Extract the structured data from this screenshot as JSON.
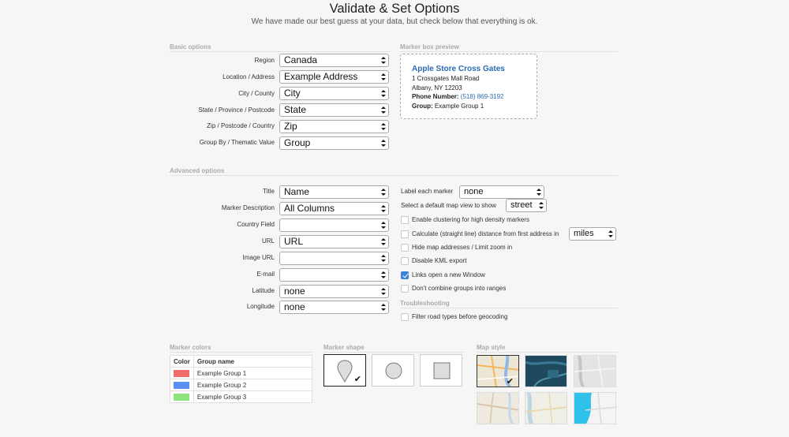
{
  "header": {
    "title": "Validate & Set Options",
    "subtitle": "We have made our best guess at your data, but check below that everything is ok."
  },
  "basic": {
    "section_label": "Basic options",
    "fields": [
      {
        "label": "Region",
        "value": "Canada"
      },
      {
        "label": "Location / Address",
        "value": "Example Address"
      },
      {
        "label": "City / County",
        "value": "City"
      },
      {
        "label": "State / Province / Postcode",
        "value": "State"
      },
      {
        "label": "Zip / Postcode / Country",
        "value": "Zip"
      },
      {
        "label": "Group By / Thematic Value",
        "value": "Group"
      }
    ]
  },
  "preview": {
    "section_label": "Marker box preview",
    "title": "Apple Store Cross Gates",
    "address1": "1 Crossgates Mall Road",
    "address2": "Albany, NY 12203",
    "phone_label": "Phone Number:",
    "phone": "(518) 869-3192",
    "group_label": "Group:",
    "group": "Example Group 1"
  },
  "advanced": {
    "section_label": "Advanced options",
    "fields": [
      {
        "label": "Title",
        "value": "Name"
      },
      {
        "label": "Marker Description",
        "value": "All Columns"
      },
      {
        "label": "Country Field",
        "value": ""
      },
      {
        "label": "URL",
        "value": "URL"
      },
      {
        "label": "Image URL",
        "value": ""
      },
      {
        "label": "E-mail",
        "value": ""
      },
      {
        "label": "Latitude",
        "value": "none"
      },
      {
        "label": "Longitude",
        "value": "none"
      }
    ],
    "label_each_marker": {
      "label": "Label each marker",
      "value": "none"
    },
    "default_map_view": {
      "label": "Select a default map view to show",
      "value": "street"
    },
    "options": [
      {
        "label": "Enable clustering for high density markers",
        "checked": false
      },
      {
        "label": "Calculate (straight line) distance from first address in",
        "checked": false,
        "unit": "miles"
      },
      {
        "label": "Hide map addresses / Limit zoom in",
        "checked": false
      },
      {
        "label": "Disable KML export",
        "checked": false
      },
      {
        "label": "Links open a new Window",
        "checked": true
      },
      {
        "label": "Don't combine groups into ranges",
        "checked": false
      }
    ]
  },
  "troubleshooting": {
    "section_label": "Troubleshooting",
    "options": [
      {
        "label": "Filter road types before geocoding",
        "checked": false
      }
    ]
  },
  "marker_colors": {
    "section_label": "Marker colors",
    "col_color": "Color",
    "col_group": "Group name",
    "rows": [
      {
        "color": "#f26b6b",
        "name": "Example Group 1"
      },
      {
        "color": "#5b8ff2",
        "name": "Example Group 2"
      },
      {
        "color": "#8fe37d",
        "name": "Example Group 3"
      }
    ]
  },
  "marker_shape": {
    "section_label": "Marker shape",
    "shapes": [
      "pin-icon",
      "circle-icon",
      "square-icon"
    ],
    "selected": "pin-icon",
    "check": "✔"
  },
  "map_style": {
    "section_label": "Map style",
    "check": "✔"
  }
}
